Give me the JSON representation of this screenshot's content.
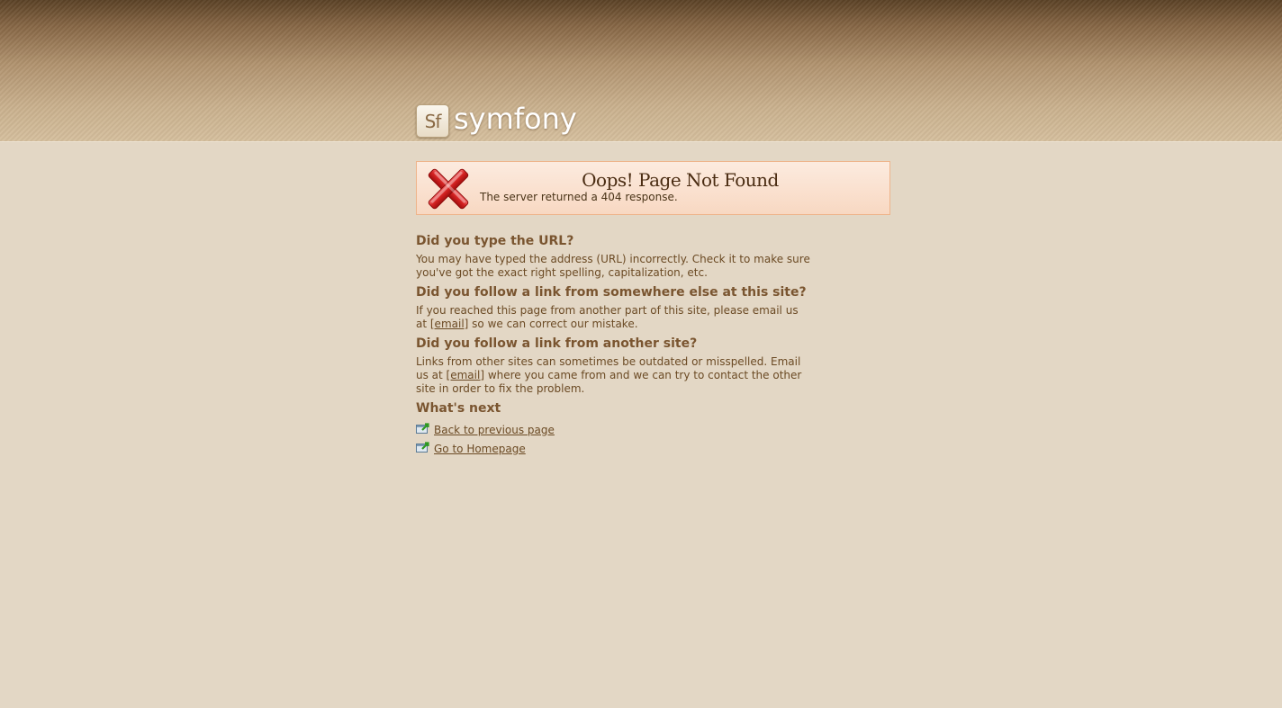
{
  "logo": {
    "badge_text": "Sf",
    "brand_text": "symfony"
  },
  "error": {
    "title": "Oops! Page Not Found",
    "subtitle": "The server returned a 404 response.",
    "icon": "red-x-icon"
  },
  "sections": [
    {
      "heading": "Did you type the URL?",
      "text": "You may have typed the address (URL) incorrectly. Check it to make sure you've got the exact right spelling, capitalization, etc."
    },
    {
      "heading": "Did you follow a link from somewhere else at this site?",
      "text_before": "If you reached this page from another part of this site, please email us at ",
      "link": "[email]",
      "text_after": " so we can correct our mistake."
    },
    {
      "heading": "Did you follow a link from another site?",
      "text_before": "Links from other sites can sometimes be outdated or misspelled. Email us at ",
      "link": "[email]",
      "text_after": " where you came from and we can try to contact the other site in order to fix the problem."
    }
  ],
  "next": {
    "heading": "What's next",
    "links": [
      {
        "label": "Back to previous page",
        "icon": "arrow-link-icon"
      },
      {
        "label": "Go to Homepage",
        "icon": "arrow-link-icon"
      }
    ]
  },
  "colors": {
    "background": "#e3d7c5",
    "text": "#6b4a24",
    "heading": "#7a5530",
    "error_border": "#eeb48a",
    "error_bg": "#fcebdf"
  }
}
